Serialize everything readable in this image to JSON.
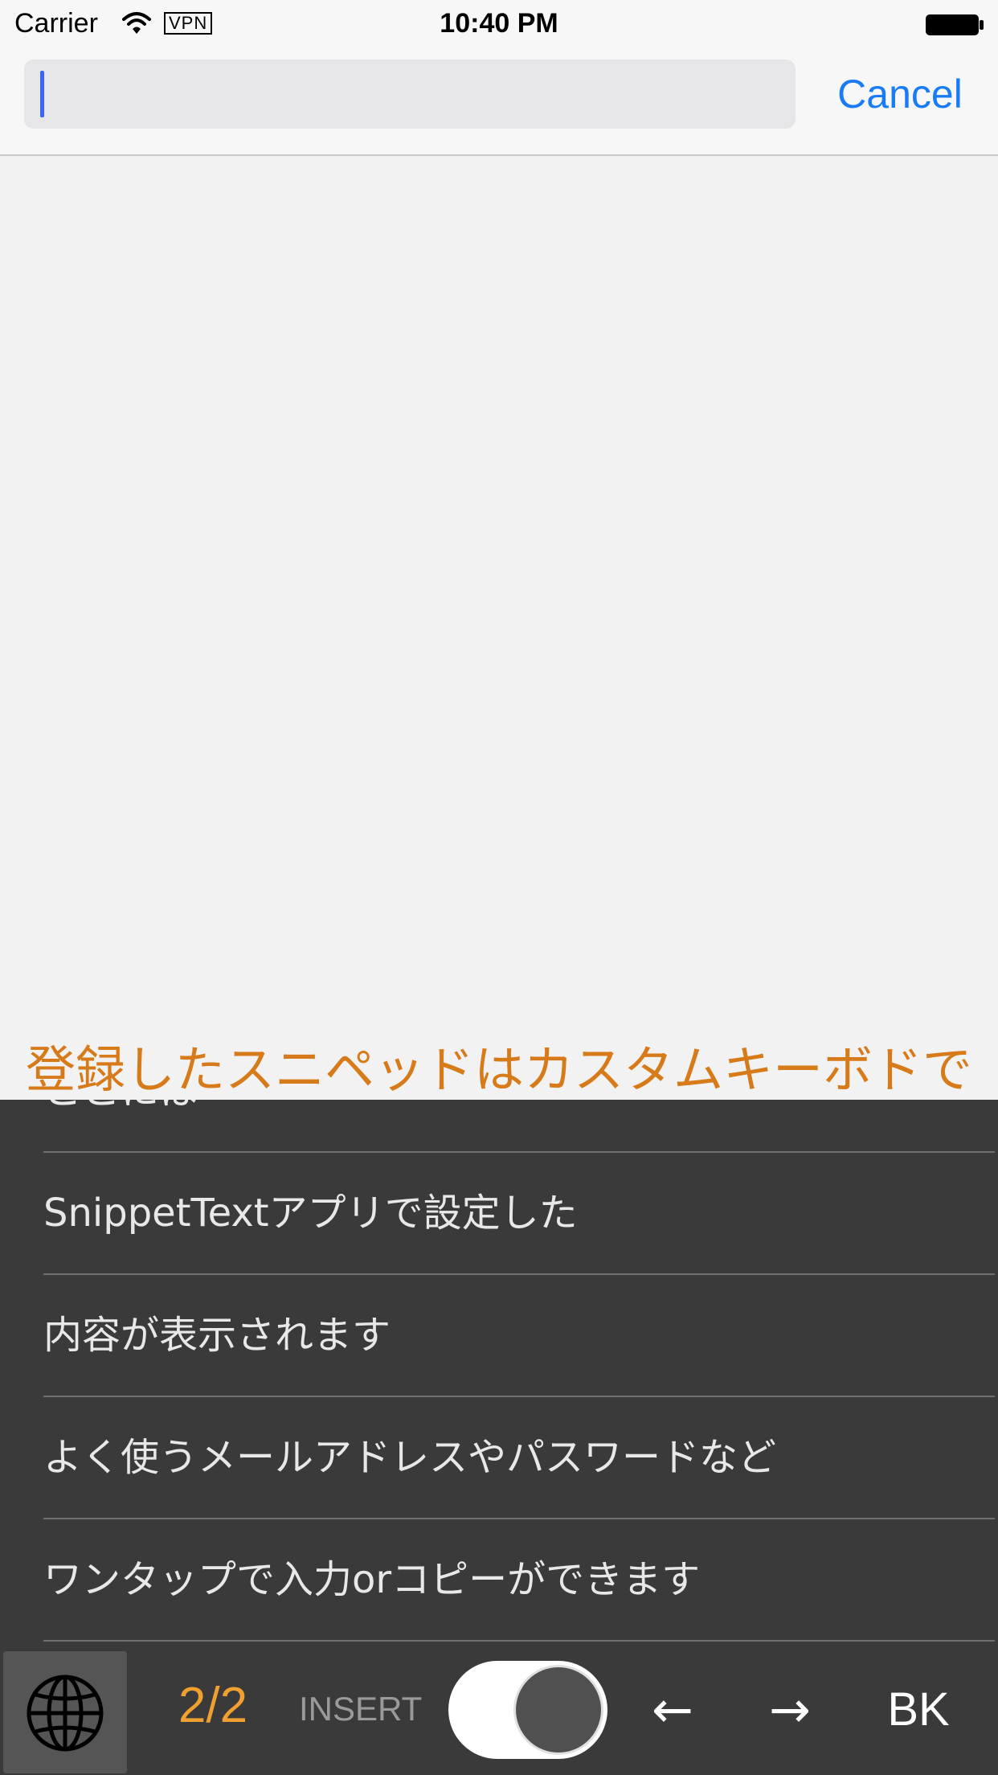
{
  "status_bar": {
    "carrier": "Carrier",
    "vpn": "VPN",
    "time": "10:40 PM"
  },
  "search": {
    "value": "",
    "placeholder": "",
    "cancel_label": "Cancel"
  },
  "banner": {
    "text": "登録したスニペッドはカスタムキーボドで"
  },
  "keyboard": {
    "snippets": [
      "ここには",
      "SnippetTextアプリで設定した",
      "内容が表示されます",
      "よく使うメールアドレスやパスワードなど",
      "ワンタップで入力orコピーができます"
    ],
    "page_indicator": "2/2",
    "insert_label": "INSERT",
    "left_arrow": "←",
    "right_arrow": "→",
    "backspace_label": "BK",
    "toggle_on": true
  },
  "colors": {
    "accent_blue": "#1a7cf5",
    "banner_orange": "#d77a1a",
    "keyboard_bg": "#3a3a3a",
    "page_indicator": "#f0a030"
  },
  "icons": [
    "wifi-icon",
    "battery-icon",
    "globe-icon"
  ]
}
